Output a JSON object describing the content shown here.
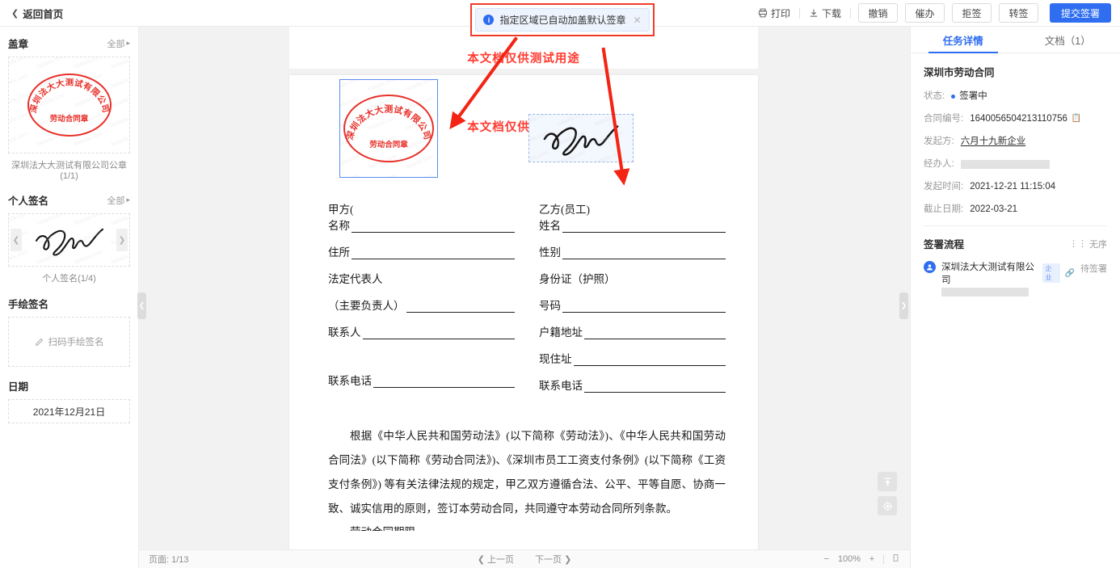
{
  "topbar": {
    "back_label": "返回首页",
    "back_icon": "chevron-left-icon",
    "print_label": "打印",
    "print_icon": "printer-icon",
    "download_label": "下载",
    "download_icon": "download-icon",
    "buttons": [
      {
        "label": "撤销"
      },
      {
        "label": "催办"
      },
      {
        "label": "拒签"
      },
      {
        "label": "转签"
      }
    ],
    "submit_label": "提交签署",
    "accent_color": "#2f6ef0"
  },
  "toast": {
    "icon": "info-icon",
    "message": "指定区域已自动加盖默认签章",
    "close_icon": "close-icon",
    "highlight_color": "#f13c2a"
  },
  "sidebar": {
    "stamp": {
      "title": "盖章",
      "all_label": "全部",
      "seal_outer_text": "深圳法大大测试有限公司",
      "seal_bottom_text": "劳动合同章",
      "caption": "深圳法大大测试有限公司公章(1/1)",
      "seal_color": "#e8312b"
    },
    "personal_signature": {
      "title": "个人签名",
      "all_label": "全部",
      "caption": "个人签名(1/4)",
      "prev_icon": "chevron-left-icon",
      "next_icon": "chevron-right-icon"
    },
    "hand_signature": {
      "title": "手绘签名",
      "action_label": "扫码手绘签名",
      "action_icon": "pencil-icon"
    },
    "date": {
      "title": "日期",
      "value": "2021年12月21日"
    },
    "watermark_text": "fadada.com"
  },
  "viewer": {
    "red_watermark": "本文档仅供测试用途",
    "document": {
      "party_a_head": "甲方(",
      "party_b_head": "乙方(员工)",
      "left_fields": [
        {
          "label": "名称",
          "line": true
        },
        {
          "label": "住所",
          "line": true
        },
        {
          "label": "法定代表人",
          "line": false
        },
        {
          "label": "（主要负责人）",
          "line": true
        },
        {
          "label": "联系人",
          "line": true
        },
        {
          "label": "",
          "line": false
        },
        {
          "label": "联系电话",
          "line": true
        }
      ],
      "right_fields": [
        {
          "label": "姓名",
          "line": true
        },
        {
          "label": "性别",
          "line": true
        },
        {
          "label": "身份证（护照）",
          "line": false
        },
        {
          "label": "号码",
          "line": true
        },
        {
          "label": "户籍地址",
          "line": true
        },
        {
          "label": "现住址",
          "line": true
        },
        {
          "label": "联系电话",
          "line": true
        }
      ],
      "paragraph": "根据《中华人民共和国劳动法》(以下简称《劳动法》)、《中华人民共和国劳动合同法》(以下简称《劳动合同法》)、《深圳市员工工资支付条例》(以下简称《工资支付条例》) 等有关法律法规的规定，甲乙双方遵循合法、公平、平等自愿、协商一致、诚实信用的原则，签订本劳动合同，共同遵守本劳动合同所列条款。",
      "paragraph_next": "劳动合同期限"
    },
    "float_buttons": [
      {
        "icon": "scroll-to-top-icon"
      },
      {
        "icon": "locate-target-icon"
      }
    ],
    "bottombar": {
      "page_label": "页面:",
      "page_value": "1/13",
      "prev_page": "上一页",
      "next_page": "下一页",
      "zoom_out": "−",
      "zoom_value": "100%",
      "zoom_in": "+",
      "fit_icon": "fit-page-icon"
    },
    "handles": {
      "left_icon": "chevron-left-icon",
      "right_icon": "chevron-right-icon"
    }
  },
  "right_panel": {
    "tabs": [
      {
        "label": "任务详情",
        "active": true
      },
      {
        "label": "文档（1）",
        "active": false
      }
    ],
    "doc_title": "深圳市劳动合同",
    "details": [
      {
        "key": "状态:",
        "value": "签署中",
        "type": "status"
      },
      {
        "key": "合同编号:",
        "value": "1640056504213110756",
        "type": "copyable"
      },
      {
        "key": "发起方:",
        "value": "六月十九新企业",
        "type": "link"
      },
      {
        "key": "经办人:",
        "value": "",
        "type": "redacted"
      },
      {
        "key": "发起时间:",
        "value": "2021-12-21 11:15:04",
        "type": "text"
      },
      {
        "key": "截止日期:",
        "value": "2022-03-21",
        "type": "text"
      }
    ],
    "flow": {
      "title": "签署流程",
      "order_label": "无序",
      "order_icon": "unordered-icon",
      "items": [
        {
          "name": "深圳法大大测试有限公司",
          "badge": "企业",
          "link_icon": "link-icon",
          "status": "待签署",
          "avatar_icon": "user-icon"
        }
      ]
    }
  }
}
